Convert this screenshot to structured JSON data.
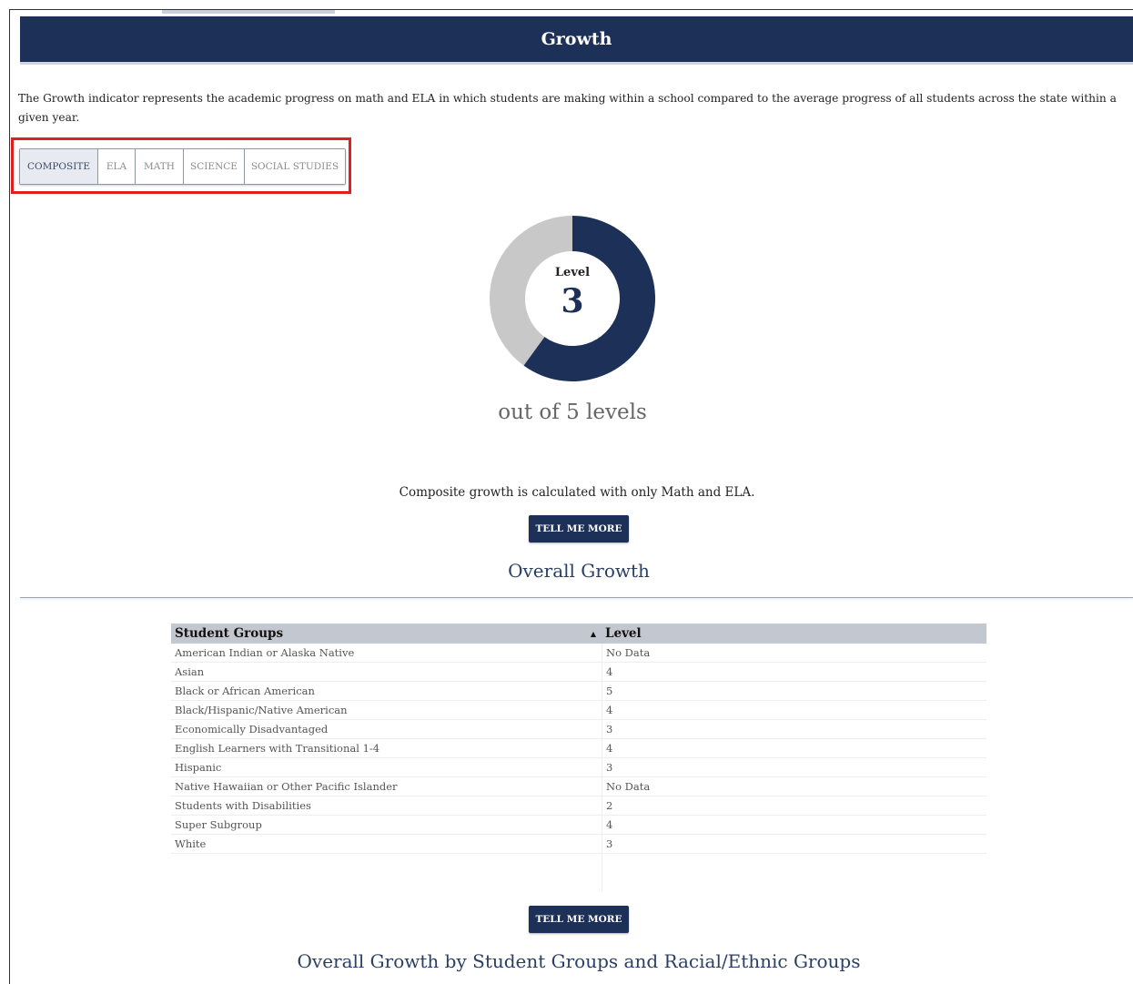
{
  "header": {
    "title": "Growth"
  },
  "description": "The Growth indicator represents the academic progress on math and ELA in which students are making within a school compared to the average progress of all students across the state within a given year.",
  "tabs": [
    {
      "label": "COMPOSITE",
      "active": true
    },
    {
      "label": "ELA",
      "active": false
    },
    {
      "label": "MATH",
      "active": false
    },
    {
      "label": "SCIENCE",
      "active": false
    },
    {
      "label": "SOCIAL STUDIES",
      "active": false
    }
  ],
  "gauge": {
    "label": "Level",
    "value": "3",
    "max": 5,
    "caption": "out of 5 levels",
    "filled_color": "#1d3158",
    "empty_color": "#c8c8c8"
  },
  "composite_note": "Composite growth is calculated with only Math and ELA.",
  "buttons": {
    "tell_me_more_1": "TELL ME MORE",
    "tell_me_more_2": "TELL ME MORE"
  },
  "sections": {
    "overall_growth": "Overall Growth",
    "by_groups": "Overall Growth by Student Groups and Racial/Ethnic Groups"
  },
  "table": {
    "headers": {
      "group": "Student Groups",
      "level": "Level"
    },
    "sort_icon": "sort-ascending-icon",
    "rows": [
      {
        "group": "American Indian or Alaska Native",
        "level": "No Data"
      },
      {
        "group": "Asian",
        "level": "4"
      },
      {
        "group": "Black or African American",
        "level": "5"
      },
      {
        "group": "Black/Hispanic/Native American",
        "level": "4"
      },
      {
        "group": "Economically Disadvantaged",
        "level": "3"
      },
      {
        "group": "English Learners with Transitional 1-4",
        "level": "4"
      },
      {
        "group": "Hispanic",
        "level": "3"
      },
      {
        "group": "Native Hawaiian or Other Pacific Islander",
        "level": "No Data"
      },
      {
        "group": "Students with Disabilities",
        "level": "2"
      },
      {
        "group": "Super Subgroup",
        "level": "4"
      },
      {
        "group": "White",
        "level": "3"
      }
    ]
  },
  "colors": {
    "primary": "#1d3158",
    "highlight": "#e02020"
  }
}
